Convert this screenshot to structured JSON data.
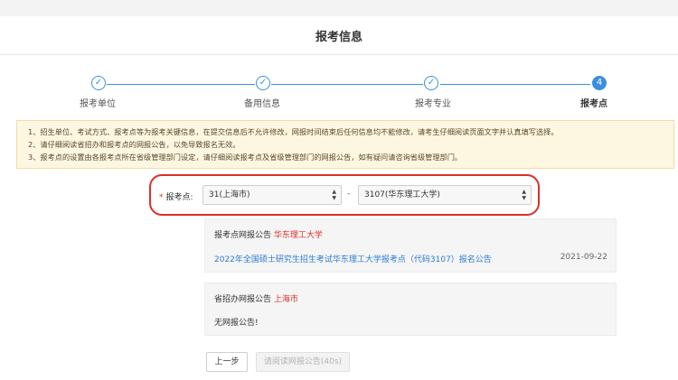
{
  "header": {
    "title": "报考信息"
  },
  "steps": [
    {
      "label": "报考单位",
      "mark": "✓"
    },
    {
      "label": "备用信息",
      "mark": "✓"
    },
    {
      "label": "报考专业",
      "mark": "✓"
    },
    {
      "label": "报考点",
      "mark": "4"
    }
  ],
  "colors": {
    "accent": "#3b8fdd",
    "highlight": "#d9302b",
    "notice_bg": "#fdf6e1"
  },
  "notice": {
    "lines": [
      "1、招生单位、考试方式、报考点等为报考关键信息，在提交信息后不允许修改，网报时间结束后任何信息均不能修改，请考生仔细阅读页面文字并认真填写选择。",
      "2、请仔细阅读省招办和报考点的网报公告，以免导致报名无效。",
      "3、报考点的设置由各报考点所在省级管理部门设定，请仔细阅读报考点及省级管理部门的网报公告，如有疑问请咨询省级管理部门。"
    ]
  },
  "form": {
    "required_mark": "*",
    "label": "报考点:",
    "province_value": "31(上海市)",
    "separator": "-",
    "site_value": "3107(华东理工大学)",
    "arrows": "▲▼"
  },
  "cards": {
    "site": {
      "heading": "报考点网报公告",
      "heading_name": "华东理工大学",
      "link": "2022年全国硕士研究生招生考试华东理工大学报考点（代码3107）报名公告",
      "date": "2021-09-22"
    },
    "province": {
      "heading": "省招办网报公告",
      "heading_name": "上海市",
      "empty_text": "无网报公告!"
    }
  },
  "buttons": {
    "prev": "上一步",
    "next": "请阅读网报公告(40s)"
  }
}
